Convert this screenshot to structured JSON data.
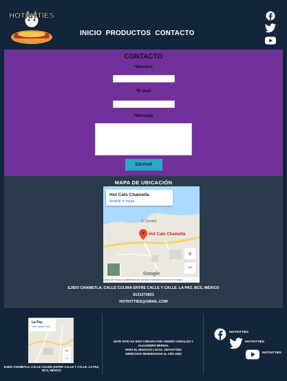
{
  "header": {
    "logo_text": "HOTKITTIES",
    "nav": [
      "INICIO",
      "PRODUCTOS",
      "CONTACTO"
    ]
  },
  "contact": {
    "title": "CONTACTO",
    "name_label": "*Nombre",
    "email_label": "*E-mail",
    "message_label": "*Mensaje",
    "send_label": "ENVIAR"
  },
  "map_section": {
    "title": "MAPA DE UBICACIÓN",
    "place_name": "Hot Cats Chametla",
    "enlarge_link": "Ampliar el mapa",
    "area_label": "El Zacatal",
    "pin_label": "Hot Cats Chametla",
    "google_label": "Google",
    "attribution": "Datos del mapa   Condiciones del Servicio   Informar un error en el mapa",
    "address": "EJIDO CHAMETLA, CALLE COLIMA ENTRE CALLE Y CALLE. LA PAZ, BCS, MÉXICO",
    "phone": "6121273821",
    "email": "HOTKITTIES@GMAIL.COM"
  },
  "footer": {
    "mini_map_title": "La Paz",
    "mini_map_link": "View larger map",
    "address": "EJIDO CHAMETLA, CALLE COLIMA ENTRE CALLE Y CALLE. LA PAZ, BCS, MÉXICO",
    "credits": [
      "ESTE SITIO HA SIDO CREADO POR ANDRÉS GERALDO Y ALEJANDRO BERNAL",
      "PARA EL NEGOCIO LOCAL: HOTKITTIES",
      "DERECHOS RESERVADOS AL AÑO 2020"
    ],
    "social": [
      "/HOTKITTIES",
      "/HOTKITTIES",
      "/HOTKITTIES"
    ]
  },
  "colors": {
    "background": "#13253a",
    "contact_bg": "#72309a",
    "map_section_bg": "#2b3b4b",
    "send_button": "#2aa9c6"
  }
}
